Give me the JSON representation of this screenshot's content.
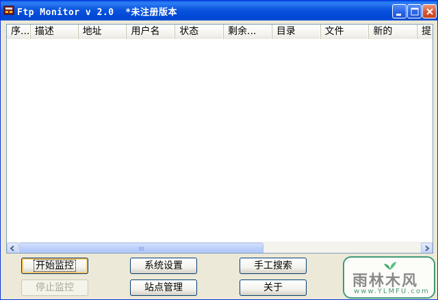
{
  "window": {
    "title": "Ftp Monitor v 2.0  *未注册版本"
  },
  "listview": {
    "columns": [
      {
        "label": "序..."
      },
      {
        "label": "描述"
      },
      {
        "label": "地址"
      },
      {
        "label": "用户名"
      },
      {
        "label": "状态"
      },
      {
        "label": "剩余..."
      },
      {
        "label": "目录"
      },
      {
        "label": "文件"
      },
      {
        "label": "新的"
      },
      {
        "label": "提"
      }
    ],
    "rows": []
  },
  "buttons": {
    "start_monitor": "开始监控",
    "stop_monitor": "停止监控",
    "system_settings": "系统设置",
    "site_management": "站点管理",
    "manual_search": "手工搜索",
    "about": "关于"
  },
  "watermark": {
    "text": "雨林木风",
    "url": "www.YLMFU.com"
  },
  "colors": {
    "titlebar": "#0054E3",
    "window_bg": "#ECE9D8",
    "accent_focus": "#F8B94B"
  }
}
